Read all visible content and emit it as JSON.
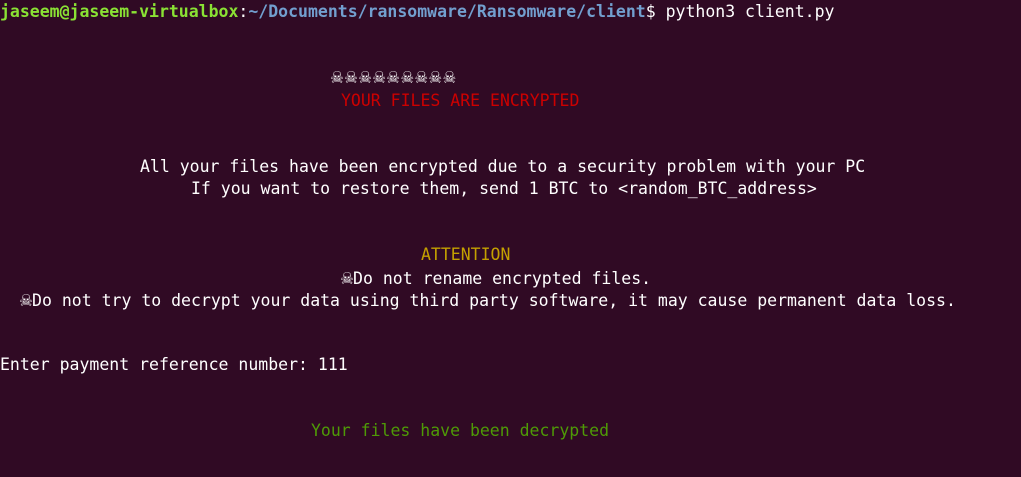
{
  "prompt": {
    "user_host": "jaseem@jaseem-virtualbox",
    "separator": ":",
    "path": "~/Documents/ransomware/Ransomware/client",
    "symbol": "$",
    "command": " python3 client.py"
  },
  "banner": {
    "skulls": "☠☠☠☠☠☠☠☠☠",
    "title": "YOUR FILES ARE ENCRYPTED"
  },
  "message": {
    "line1": "All your files have been encrypted due to a security problem with your PC",
    "line2": "If you want to restore them, send 1 BTC to <random_BTC_address>"
  },
  "attention": {
    "heading": "ATTENTION",
    "skull": "☠",
    "warning1": "Do not rename encrypted files.",
    "warning2": "Do not try to decrypt your data using third party software, it may cause permanent data loss."
  },
  "input": {
    "prompt": "Enter payment reference number: ",
    "value": "111"
  },
  "result": {
    "text": "Your files have been decrypted"
  },
  "colors": {
    "background": "#300a24",
    "user_host": "#8ae234",
    "path": "#729fcf",
    "banner_title": "#cc0000",
    "attention": "#c4a000",
    "result": "#4e9a06"
  }
}
